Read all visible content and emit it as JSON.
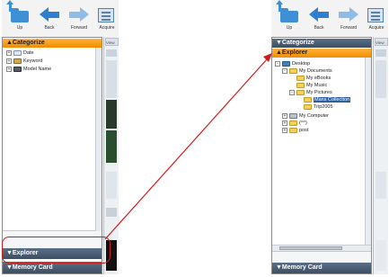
{
  "toolbar": {
    "buttons": [
      {
        "id": "up",
        "label": "Up",
        "icon": "folder-up-icon"
      },
      {
        "id": "back",
        "label": "Back",
        "icon": "back-arrow-icon"
      },
      {
        "id": "forward",
        "label": "Forward",
        "icon": "forward-arrow-icon"
      },
      {
        "id": "acquire",
        "label": "Acquire",
        "icon": "acquire-icon"
      }
    ]
  },
  "left_panel": {
    "categorize_header": "▲Categorize",
    "tree": [
      {
        "label": "Date",
        "icon": "calendar-icon",
        "expander": "+"
      },
      {
        "label": "Keyword",
        "icon": "key-icon",
        "expander": "+"
      },
      {
        "label": "Model Name",
        "icon": "camera-icon",
        "expander": "+"
      }
    ],
    "explorer_header": "▼Explorer",
    "memory_card_header": "▼Memory Card",
    "viewer_tab": "View"
  },
  "right_panel": {
    "categorize_header": "▼Categorize",
    "explorer_header": "▲Explorer",
    "tree": [
      {
        "label": "Desktop",
        "icon": "desktop-icon",
        "expander": "-"
      },
      {
        "label": "My Documents",
        "icon": "folder-icon",
        "expander": "-"
      },
      {
        "label": "My eBooks",
        "icon": "folder-icon",
        "expander": ""
      },
      {
        "label": "My Music",
        "icon": "folder-icon",
        "expander": ""
      },
      {
        "label": "My Pictures",
        "icon": "folder-icon",
        "expander": "-"
      },
      {
        "label": "Mans Collection",
        "icon": "folder-icon",
        "expander": "",
        "selected": true
      },
      {
        "label": "Trip2005",
        "icon": "folder-icon",
        "expander": ""
      },
      {
        "label": "My Computer",
        "icon": "computer-icon",
        "expander": "+"
      },
      {
        "label": "(^^)",
        "icon": "folder-icon",
        "expander": "+"
      },
      {
        "label": "post",
        "icon": "folder-icon",
        "expander": "+"
      }
    ],
    "memory_card_header": "▼Memory Card",
    "viewer_tab": "View"
  },
  "colors": {
    "header_active": "#f08c00",
    "header_inactive": "#3c4e63",
    "selection": "#2f5f9f",
    "annotation": "#d11a1a"
  }
}
